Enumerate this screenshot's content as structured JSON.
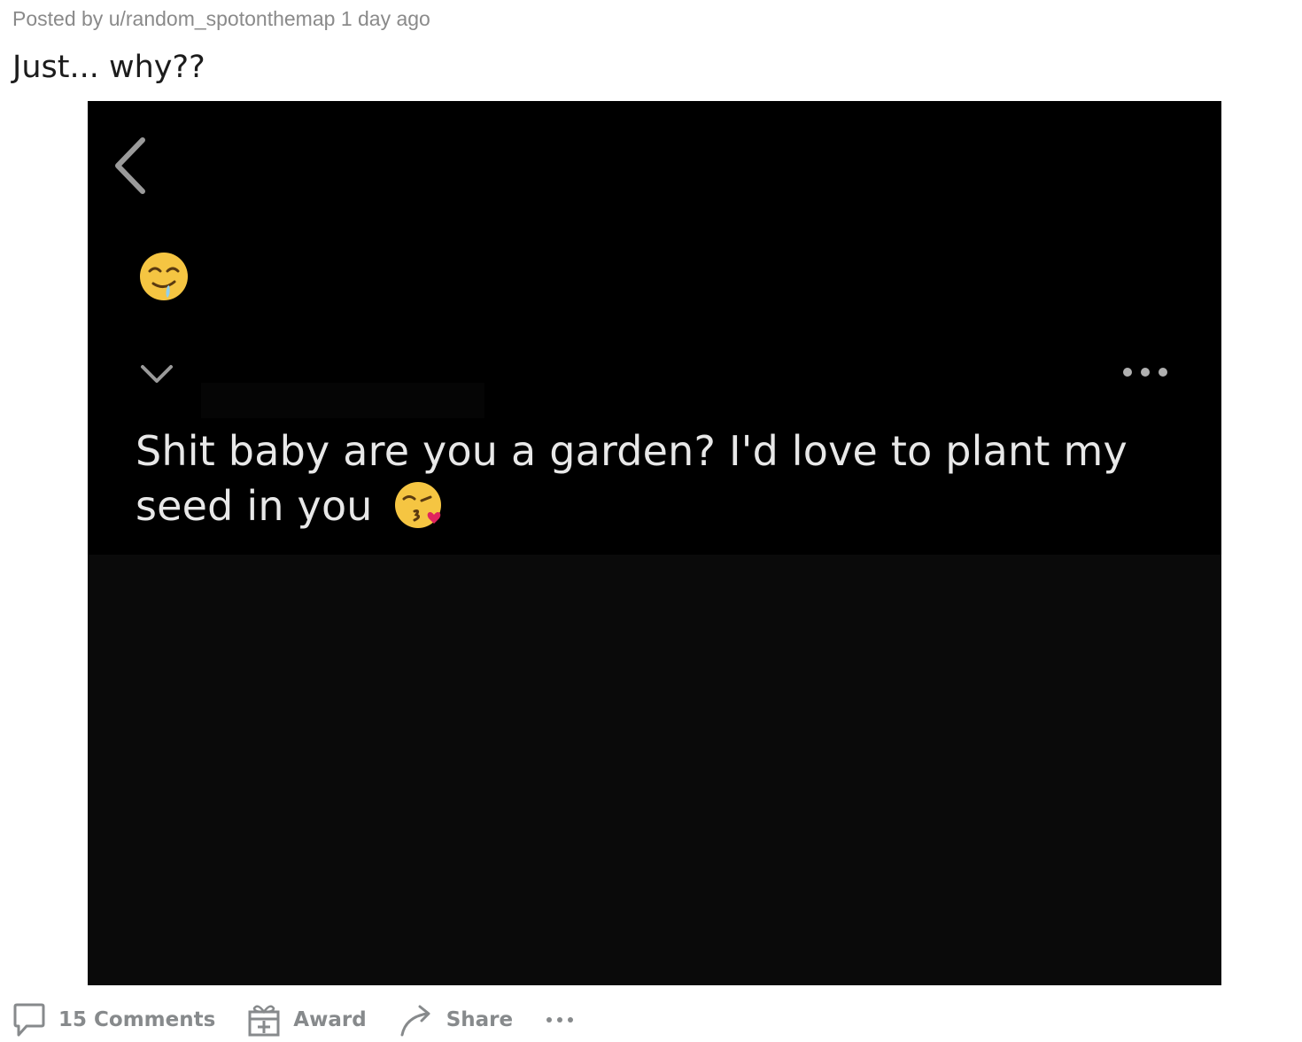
{
  "post": {
    "posted_by_prefix": "Posted by",
    "username": "u/random_spotonthemap",
    "time_ago": "1 day ago",
    "title": "Just... why??"
  },
  "media": {
    "message_text": "Shit baby are you a garden? I'd love to plant my seed in you",
    "icons": [
      "back-chevron-icon",
      "drooling-face-emoji",
      "chevron-down-icon",
      "more-options-icon",
      "kissing-face-emoji"
    ],
    "colors": {
      "background_top": "#000000",
      "background_bottom": "#0a0a0a",
      "message_text": "#e8e8e8"
    }
  },
  "actions": {
    "comments_label": "15 Comments",
    "award_label": "Award",
    "share_label": "Share",
    "more_label": "..."
  },
  "colors": {
    "meta_text": "#8a8a8a",
    "title_text": "#1c1c1c",
    "action_text": "#878a8c"
  }
}
